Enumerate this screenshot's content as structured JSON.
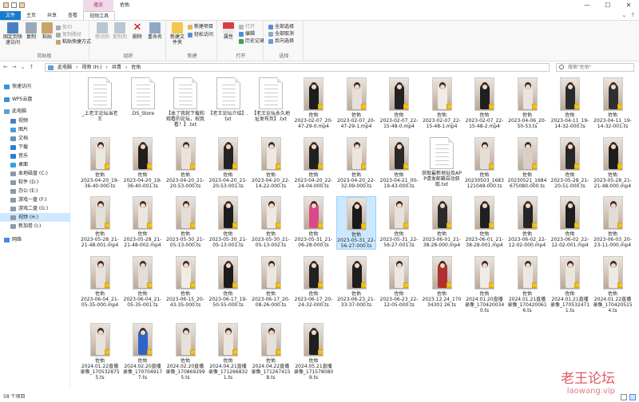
{
  "window": {
    "context_tab": "播放",
    "title": "佐佑",
    "controls": [
      "—",
      "☐",
      "✕"
    ]
  },
  "tabs": [
    "文件",
    "主页",
    "共享",
    "查看",
    "视频工具"
  ],
  "ribbon": {
    "clipboard": {
      "pin": "固定到快速访问",
      "copy": "复制",
      "paste": "粘贴",
      "cut": "剪切",
      "copy_path": "复制路径",
      "paste_shortcut": "粘贴快捷方式",
      "label": "剪贴板"
    },
    "organize": {
      "move_to": "移动到",
      "copy_to": "复制到",
      "delete": "删除",
      "rename": "重命名",
      "label": "组织"
    },
    "new": {
      "new_folder": "新建文件夹",
      "new_item": "新建项目",
      "easy_access": "轻松访问",
      "label": "新建"
    },
    "open": {
      "properties": "属性",
      "open": "打开",
      "edit": "编辑",
      "history": "历史记录",
      "label": "打开"
    },
    "select": {
      "select_all": "全部选择",
      "select_none": "全部取消",
      "invert": "反向选择",
      "label": "选择"
    }
  },
  "address": {
    "crumbs": [
      "此电脑",
      "视频 (H:)",
      "共青",
      "佐佑"
    ],
    "search_placeholder": "搜索\"佐佑\""
  },
  "nav": {
    "items": [
      {
        "label": "快速访问",
        "icon": "star-icon",
        "color": "#3b8fe0",
        "level": 0
      },
      {
        "label": "WPS云盘",
        "icon": "cloud-icon",
        "color": "#3b8fe0",
        "level": 0
      },
      {
        "label": "此电脑",
        "icon": "computer-icon",
        "color": "#5ea0d8",
        "level": 0
      },
      {
        "label": "视频",
        "icon": "video-folder-icon",
        "color": "#4a7fbf",
        "level": 1
      },
      {
        "label": "图片",
        "icon": "pictures-folder-icon",
        "color": "#4a9fd8",
        "level": 1
      },
      {
        "label": "文档",
        "icon": "documents-folder-icon",
        "color": "#6a8fb8",
        "level": 1
      },
      {
        "label": "下载",
        "icon": "download-folder-icon",
        "color": "#2a7fd0",
        "level": 1
      },
      {
        "label": "音乐",
        "icon": "music-folder-icon",
        "color": "#2a7fd0",
        "level": 1
      },
      {
        "label": "桌面",
        "icon": "desktop-folder-icon",
        "color": "#3a9fe0",
        "level": 1
      },
      {
        "label": "本地磁盘 (C:)",
        "icon": "drive-icon",
        "color": "#8a9aaa",
        "level": 1
      },
      {
        "label": "软件 (D:)",
        "icon": "drive-icon",
        "color": "#8a9aaa",
        "level": 1
      },
      {
        "label": "办公 (E:)",
        "icon": "drive-icon",
        "color": "#8a9aaa",
        "level": 1
      },
      {
        "label": "游戏一盘 (F:)",
        "icon": "drive-icon",
        "color": "#8a9aaa",
        "level": 1
      },
      {
        "label": "游戏二盘 (G:)",
        "icon": "drive-icon",
        "color": "#8a9aaa",
        "level": 1
      },
      {
        "label": "视频 (H:)",
        "icon": "drive-icon",
        "color": "#8a9aaa",
        "level": 1,
        "selected": true
      },
      {
        "label": "新加卷 (I:)",
        "icon": "drive-icon",
        "color": "#8a9aaa",
        "level": 1
      },
      {
        "label": "网络",
        "icon": "network-icon",
        "color": "#3b8fe0",
        "level": 0
      }
    ]
  },
  "files": [
    {
      "name": "_上老王论坛当老王",
      "type": "doc"
    },
    {
      "name": ".DS_Store",
      "type": "doc"
    },
    {
      "name": "【本了我就下载和观看的论坛，祝我看！】.txt",
      "type": "doc"
    },
    {
      "name": "【老王论坛介绍】.txt",
      "type": "doc"
    },
    {
      "name": "【老王论坛永久地址发布页】.txt",
      "type": "doc"
    },
    {
      "name": "2023-02-07_20-47-29-0.mp4",
      "type": "video",
      "c": "#1c1c1c"
    },
    {
      "name": "2023-02-07_20-47-29-1.mp4",
      "type": "video",
      "c": "#e6e0da"
    },
    {
      "name": "2023-02-07_22-15-48-0.mp4",
      "type": "video",
      "c": "#222"
    },
    {
      "name": "2023-02-07_22-15-48-1.mp4",
      "type": "video",
      "c": "#f0ece8"
    },
    {
      "name": "2023-02-07_22-15-48-2.mp4",
      "type": "video",
      "c": "#1f1f1f"
    },
    {
      "name": "2023-04-06_20-50-53.ts",
      "type": "video",
      "c": "#e8e4df"
    },
    {
      "name": "2023-04-11_19-14-32-000.ts",
      "type": "video",
      "c": "#2a2a2a"
    },
    {
      "name": "2023-04-11_19-14-32-001.ts",
      "type": "video",
      "c": "#303030"
    },
    {
      "name": "2023-04-20_19-36-40-000.ts",
      "type": "video",
      "c": "#ece7e1"
    },
    {
      "name": "2023-04-20_19-36-40-001.ts",
      "type": "video",
      "c": "#1e1e1e"
    },
    {
      "name": "2023-04-20_21-20-53-000.ts",
      "type": "video",
      "c": "#e9e3dc"
    },
    {
      "name": "2023-04-20_21-20-53-001.ts",
      "type": "video",
      "c": "#242424"
    },
    {
      "name": "2023-04-20_22-14-22-000.ts",
      "type": "video",
      "c": "#efe9e2"
    },
    {
      "name": "2023-04-20_22-24-04-000.ts",
      "type": "video",
      "c": "#202020"
    },
    {
      "name": "2023-04-20_22-32-09-000.ts",
      "type": "video",
      "c": "#ede6df"
    },
    {
      "name": "2023-04-21_00-19-43-000.ts",
      "type": "video",
      "c": "#282828"
    },
    {
      "name": "获取最新地址及APP请发邮箱自动获取.txt",
      "type": "doc"
    },
    {
      "name": "20230503_1683121049-000.ts",
      "type": "video",
      "c": "#e4ded7"
    },
    {
      "name": "20230521_1684675080-000.ts",
      "type": "video",
      "c": "#d8d0c8"
    },
    {
      "name": "2023-05-28_21-20-51-000.ts",
      "type": "video",
      "c": "#262626"
    },
    {
      "name": "2023-05-28_21-21-48-000.mp4",
      "type": "video",
      "c": "#1d1d1d"
    },
    {
      "name": "2023-05-28_21-21-48-001.mp4",
      "type": "video",
      "c": "#e6e0da"
    },
    {
      "name": "2023-05-28_21-21-48-002.mp4",
      "type": "video",
      "c": "#ebe6e0"
    },
    {
      "name": "2023-05-30_21-05-13-000.ts",
      "type": "video",
      "c": "#e4ded8"
    },
    {
      "name": "2023-05-30_21-05-13-001.ts",
      "type": "video",
      "c": "#1c1c1c"
    },
    {
      "name": "2023-05-30_21-05-13-002.ts",
      "type": "video",
      "c": "#efe9e3"
    },
    {
      "name": "2023-05-31_21-06-28-000.ts",
      "type": "video",
      "c": "#d84a8a"
    },
    {
      "name": "2023-05-31_22-56-27-000.ts",
      "type": "video",
      "c": "#1a1a1a",
      "selected": true
    },
    {
      "name": "2023-05-31_22-56-27-001.ts",
      "type": "video",
      "c": "#e7e1db"
    },
    {
      "name": "2023-06-01_21-38-28-000.mp4",
      "type": "video",
      "c": "#2a2a2a"
    },
    {
      "name": "2023-06-01_21-38-28-001.mp4",
      "type": "video",
      "c": "#1f1f1f"
    },
    {
      "name": "2023-06-02_22-12-02-000.mp4",
      "type": "video",
      "c": "#252525"
    },
    {
      "name": "2023-06-02_22-12-02-001.mp4",
      "type": "video",
      "c": "#1d1d1d"
    },
    {
      "name": "2023-06-03_20-23-11-000.mp4",
      "type": "video",
      "c": "#e2dcd5"
    },
    {
      "name": "2023-06-04_21-05-35-000.mp4",
      "type": "video",
      "c": "#e8e2dc"
    },
    {
      "name": "2023-06-04_21-05-35-001.ts",
      "type": "video",
      "c": "#e4ded8"
    },
    {
      "name": "2023-06-15_20-43-35-000.ts",
      "type": "video",
      "c": "#f1ece6"
    },
    {
      "name": "2023-06-17_19-50-55-000.ts",
      "type": "video",
      "c": "#1c1c1c"
    },
    {
      "name": "2023-06-17_20-08-26-000.ts",
      "type": "video",
      "c": "#ece6e0"
    },
    {
      "name": "2023-06-17_20-24-32-000.ts",
      "type": "video",
      "c": "#222"
    },
    {
      "name": "2023-06-23_21-33-37-000.ts",
      "type": "video",
      "c": "#1e1e1e"
    },
    {
      "name": "2023-06-23_22-12-05-000.ts",
      "type": "video",
      "c": "#ece7e1"
    },
    {
      "name": "2023.12.24_17034301 26.ts",
      "type": "video",
      "c": "#b03030"
    },
    {
      "name": "2024.01.20直播录像_1704200340.ts",
      "type": "video",
      "c": "#f0ebe6"
    },
    {
      "name": "2024.01.21直播录像_1704200616.ts",
      "type": "video",
      "c": "#ede8e3"
    },
    {
      "name": "2024.01.21直播录像_1705324711.ts",
      "type": "video",
      "c": "#ebe5df"
    },
    {
      "name": "2024.01.22直播录像_1704205154.ts",
      "type": "video",
      "c": "#eee9e3"
    },
    {
      "name": "2024.01.22直播录像_1705328755.ts",
      "type": "video",
      "c": "#e9e3dd"
    },
    {
      "name": "2024.02.20直播录像_1707049177.ts",
      "type": "video",
      "c": "#2f63c8"
    },
    {
      "name": "2024.02.20直播录像_1708692995.ts",
      "type": "video",
      "c": "#e7e1db"
    },
    {
      "name": "2024.04.21直播录像_1712668321.ts",
      "type": "video",
      "c": "#ece6e0"
    },
    {
      "name": "2024.04.22直播录像_1712674158.ts",
      "type": "video",
      "c": "#e6e0da"
    },
    {
      "name": "2024.05.21直播录像_1715780809.ts",
      "type": "video",
      "c": "#1f1f1f"
    }
  ],
  "video_caption_prefix": "佐佑",
  "status": "58 个项目",
  "watermark": {
    "line1": "老王论坛",
    "line2": "laowang.vip"
  }
}
